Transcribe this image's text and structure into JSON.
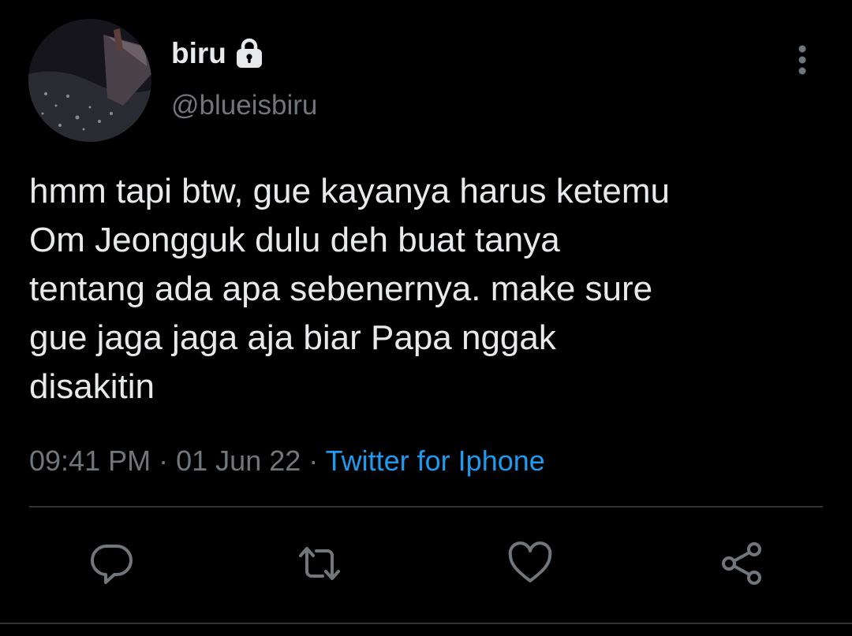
{
  "tweet": {
    "author": {
      "display_name": "biru",
      "handle": "@blueisbiru",
      "avatar_icon": "avatar-airplane-wing-night-city",
      "protected_icon": "lock-icon"
    },
    "text": "hmm tapi btw, gue kayanya harus ketemu\nOm Jeongguk dulu deh buat tanya\ntentang ada apa sebenernya. make sure\ngue jaga jaga aja biar Papa nggak\ndisakitin",
    "time": "09:41 PM",
    "date": "01 Jun 22",
    "separator": "·",
    "source": "Twitter for Iphone"
  },
  "actions": [
    {
      "name": "reply",
      "icon": "reply-icon"
    },
    {
      "name": "retweet",
      "icon": "retweet-icon"
    },
    {
      "name": "like",
      "icon": "heart-icon"
    },
    {
      "name": "share",
      "icon": "share-icon"
    }
  ],
  "colors": {
    "background": "#000000",
    "text_primary": "#e7e9ea",
    "text_secondary": "#71767b",
    "link": "#1d9bf0",
    "divider": "#2f3336"
  }
}
